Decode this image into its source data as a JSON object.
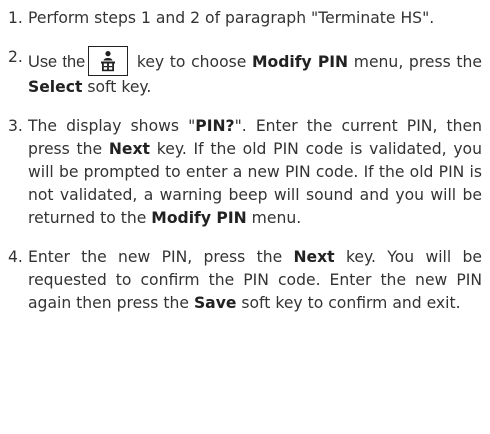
{
  "steps": [
    {
      "num": "1.",
      "text": "Perform steps 1 and 2 of paragraph \"Terminate HS\"."
    },
    {
      "num": "2.",
      "use_the": "Use the",
      "key_icon": "phonebook-key-icon",
      "after_key": " key to choose ",
      "menu": "Modify PIN",
      "after_menu": " menu, press the ",
      "softkey": "Select",
      "end": " soft key."
    },
    {
      "num": "3.",
      "p1": "The display shows \"",
      "prompt": "PIN?",
      "p2": "\". Enter the current PIN, then press the ",
      "next": "Next",
      "p3": " key. If the old PIN code is validated, you will be prompted to enter a new PIN code. If the old PIN is not validated, a warning beep will sound and you will be returned to the ",
      "menu": "Modify PIN",
      "p4": " menu."
    },
    {
      "num": "4.",
      "p1": "Enter the new PIN, press the ",
      "next": "Next",
      "p2": " key. You will be requested to confirm the PIN code. Enter the new PIN again then press the ",
      "save": "Save",
      "p3": " soft key to confirm and exit."
    }
  ]
}
